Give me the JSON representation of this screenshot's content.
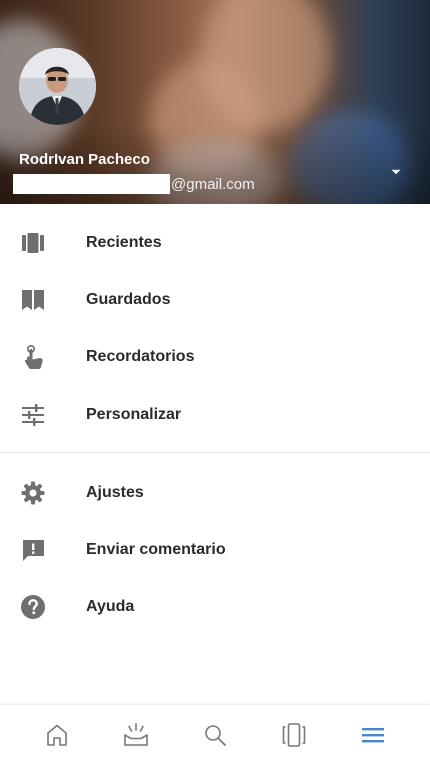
{
  "header": {
    "user_name": "RodrIvan Pacheco",
    "email_domain": "@gmail.com",
    "dropdown_icon": "caret-down-icon"
  },
  "menu": {
    "primary": [
      {
        "label": "Recientes",
        "icon": "recent-cards-icon"
      },
      {
        "label": "Guardados",
        "icon": "bookmark-icon"
      },
      {
        "label": "Recordatorios",
        "icon": "touch-hand-icon"
      },
      {
        "label": "Personalizar",
        "icon": "tune-sliders-icon"
      }
    ],
    "secondary": [
      {
        "label": "Ajustes",
        "icon": "gear-icon"
      },
      {
        "label": "Enviar comentario",
        "icon": "feedback-icon"
      },
      {
        "label": "Ayuda",
        "icon": "help-icon"
      }
    ]
  },
  "bottom_nav": {
    "items": [
      "home-icon",
      "updates-icon",
      "search-icon",
      "recent-cards-icon",
      "menu-icon"
    ],
    "active_index": 4,
    "active_color": "#4a86c5",
    "inactive_color": "#777777"
  },
  "colors": {
    "icon_gray": "#6f6f6f",
    "text": "#2b2b2b"
  }
}
